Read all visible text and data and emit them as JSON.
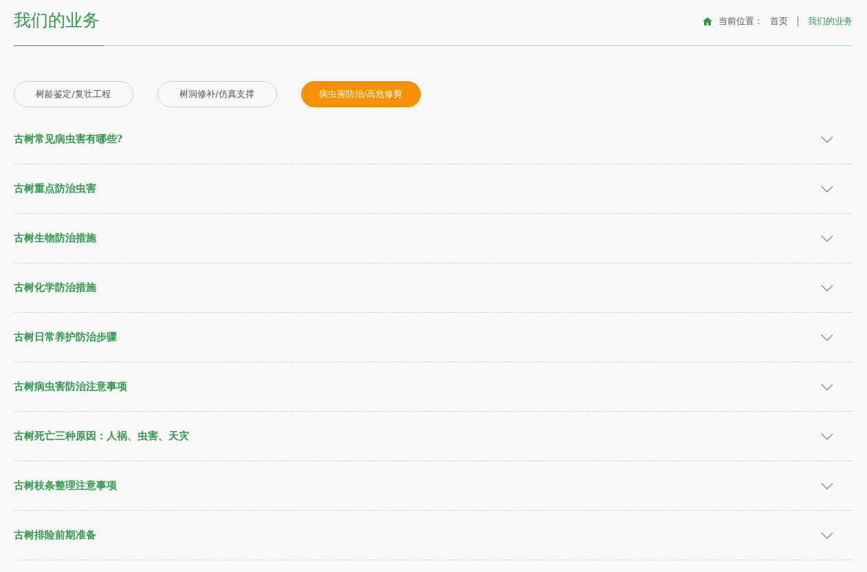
{
  "page_title": "我们的业务",
  "breadcrumb": {
    "label": "当前位置：",
    "items": [
      {
        "text": "首页",
        "current": false
      },
      {
        "text": "我们的业务",
        "current": true
      }
    ]
  },
  "tabs": [
    {
      "label": "树龄鉴定/复壮工程",
      "selected": false
    },
    {
      "label": "树洞修补/仿真支撑",
      "selected": false
    },
    {
      "label": "病虫害防治/高危修剪",
      "selected": true
    }
  ],
  "faq": [
    {
      "question": "古树常见病虫害有哪些?",
      "expanded": false
    },
    {
      "question": "古树重点防治虫害",
      "expanded": false
    },
    {
      "question": "古树生物防治措施",
      "expanded": false
    },
    {
      "question": "古树化学防治措施",
      "expanded": false
    },
    {
      "question": "古树日常养护防治步骤",
      "expanded": false
    },
    {
      "question": "古树病虫害防治注意事项",
      "expanded": false
    },
    {
      "question": "古树死亡三种原因：人祸、虫害、天灾",
      "expanded": false
    },
    {
      "question": "古树枝条整理注意事项",
      "expanded": false
    },
    {
      "question": "古树排险前期准备",
      "expanded": false
    }
  ]
}
